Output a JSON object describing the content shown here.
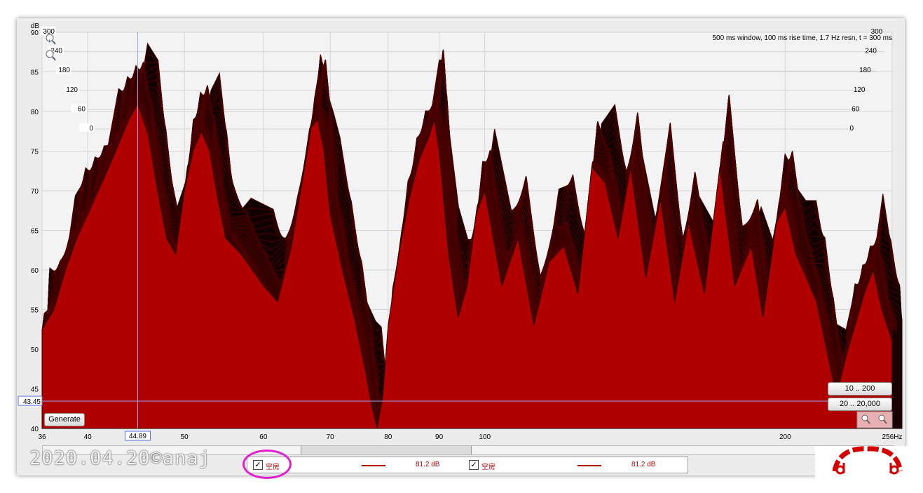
{
  "chart_data": {
    "type": "area",
    "title": "",
    "xlabel": "",
    "ylabel": "dB",
    "x_scale": "log",
    "xlim": [
      36,
      256
    ],
    "ylim": [
      40,
      90
    ],
    "x_ticks": [
      {
        "value": 36,
        "label": "36"
      },
      {
        "value": 40,
        "label": "40"
      },
      {
        "value": 50,
        "label": "50"
      },
      {
        "value": 60,
        "label": "60"
      },
      {
        "value": 70,
        "label": "70"
      },
      {
        "value": 80,
        "label": "80"
      },
      {
        "value": 90,
        "label": "90"
      },
      {
        "value": 100,
        "label": "100"
      },
      {
        "value": 200,
        "label": "200"
      },
      {
        "value": 256,
        "label": "256Hz"
      }
    ],
    "y_ticks": [
      40,
      45,
      50,
      55,
      60,
      65,
      70,
      75,
      80,
      85,
      90
    ],
    "time_ticks": [
      "0",
      "60",
      "120",
      "180",
      "240",
      "300"
    ],
    "annotation": "500 ms window, 100 ms rise time,  1.7 Hz resn, t = 300 ms",
    "cursor": {
      "x": 44.89,
      "x_label": "44.89",
      "y": 43.45,
      "y_label": "43.45"
    },
    "series": [
      {
        "x": [
          36,
          37,
          38,
          39,
          40,
          41,
          42,
          43,
          44,
          44.9,
          46,
          47,
          48,
          49,
          50,
          51,
          52,
          53,
          54,
          55,
          57,
          60,
          62,
          64,
          66,
          67,
          68,
          69,
          70,
          72,
          74,
          76,
          77,
          78,
          79,
          80,
          82,
          84,
          86,
          88,
          89,
          90,
          92,
          94,
          96,
          98,
          100,
          104,
          108,
          112,
          116,
          120,
          124,
          128,
          132,
          136,
          140,
          145,
          150,
          155,
          160,
          166,
          172,
          178,
          185,
          190,
          196,
          200,
          205,
          210,
          215,
          220,
          225,
          230,
          235,
          240,
          245,
          250,
          256
        ],
        "values": [
          52.5,
          55,
          60,
          64,
          67,
          70,
          73,
          76,
          79,
          81,
          77,
          70,
          64,
          62,
          70,
          75,
          77.5,
          75,
          69,
          64,
          62,
          58,
          56,
          63,
          73,
          78,
          79,
          75,
          67,
          60,
          54,
          47,
          43,
          40,
          44,
          53,
          62,
          69,
          74,
          77,
          79,
          75,
          62,
          54,
          58,
          67,
          70,
          58,
          64,
          53,
          61,
          63,
          57,
          73,
          71,
          64,
          73,
          59,
          69,
          56,
          66,
          57,
          73,
          58,
          63,
          54,
          66,
          68,
          62,
          59,
          56,
          50,
          44,
          49,
          53,
          57,
          60,
          55,
          51
        ]
      }
    ]
  },
  "buttons": {
    "generate": "Generate",
    "range1": "10 .. 200",
    "range2": "20 .. 20,000"
  },
  "legend": {
    "items": [
      {
        "name": "空房",
        "value": "81.2 dB",
        "checked": "✓"
      },
      {
        "name": "空房",
        "value": "81.2 dB",
        "checked": "✓"
      }
    ]
  },
  "watermark": "2020.04.20©anaj",
  "colors": {
    "fill": "#b00000",
    "ridge": "#1a0000",
    "grid": "#d4d4d4",
    "plot_bg": "#ececec",
    "cursor": "#5c6fe0",
    "highlight": "#e020d0"
  }
}
